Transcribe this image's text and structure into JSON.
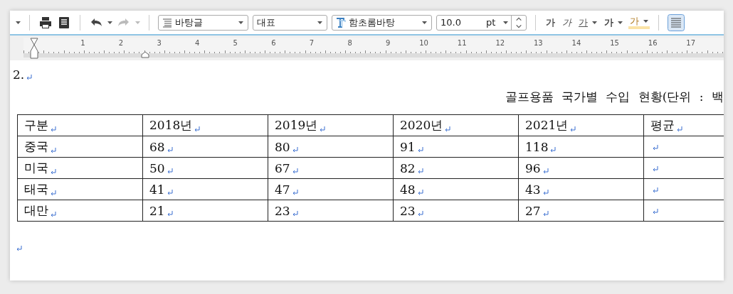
{
  "toolbar": {
    "history_buttons": [
      {
        "kind": "undo",
        "disabled": false
      },
      {
        "kind": "redo",
        "disabled": true
      }
    ],
    "style": "바탕글",
    "outline": "대표",
    "font": "함초롬바탕",
    "size": "10.0",
    "unit": "pt",
    "format_buttons": [
      {
        "label": "가",
        "kind": "bold",
        "menu": false
      },
      {
        "label": "가",
        "kind": "italic",
        "menu": false
      },
      {
        "label": "가",
        "kind": "underline",
        "menu": true
      },
      {
        "label": "가",
        "kind": "strike",
        "menu": true
      },
      {
        "label": "가",
        "kind": "highlight",
        "menu": true
      }
    ],
    "align_justify": {
      "selected": true
    }
  },
  "ruler": {
    "numbers": [
      "1",
      "2",
      "3",
      "4",
      "5",
      "6",
      "7",
      "8",
      "9",
      "10",
      "11",
      "12",
      "13",
      "14",
      "15",
      "16",
      "17"
    ]
  },
  "document": {
    "heading": "2.",
    "caption": "골프용품 국가별 수입 현황(단위 : 백",
    "table": {
      "columns": [
        "구분",
        "2018년",
        "2019년",
        "2020년",
        "2021년",
        "평균"
      ],
      "rows": [
        {
          "label": "중국",
          "values": [
            "68",
            "80",
            "91",
            "118"
          ]
        },
        {
          "label": "미국",
          "values": [
            "50",
            "67",
            "82",
            "96"
          ]
        },
        {
          "label": "태국",
          "values": [
            "41",
            "47",
            "48",
            "43"
          ]
        },
        {
          "label": "대만",
          "values": [
            "21",
            "23",
            "23",
            "27"
          ]
        }
      ]
    }
  }
}
